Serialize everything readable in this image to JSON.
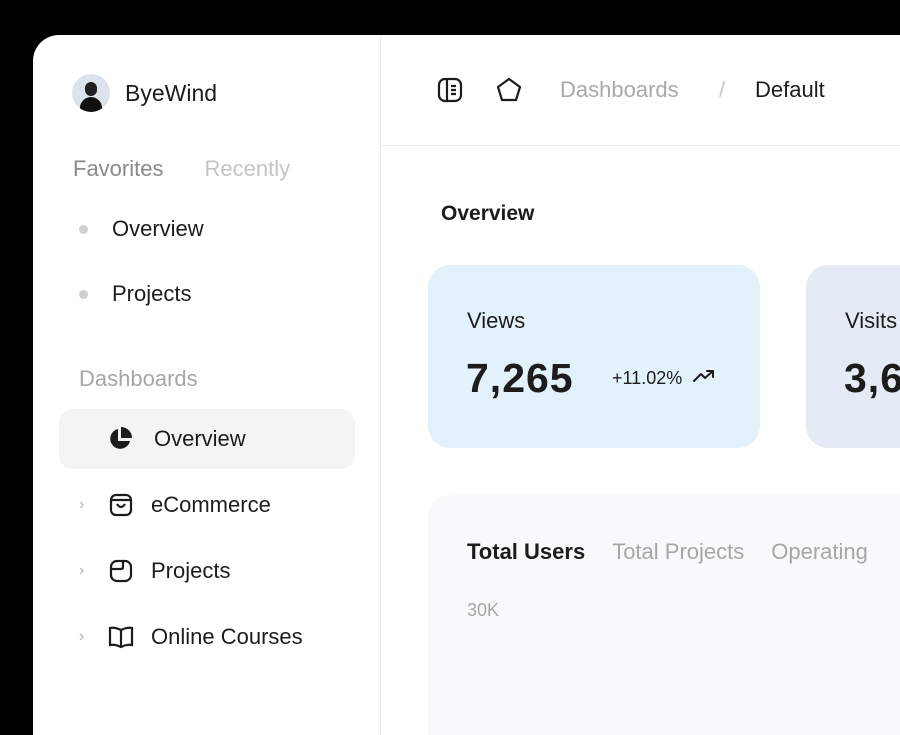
{
  "sidebar": {
    "brand": "ByeWind",
    "tabs": [
      "Favorites",
      "Recently"
    ],
    "favorites": [
      "Overview",
      "Projects"
    ],
    "section": "Dashboards",
    "active_item": "Overview",
    "items": [
      "eCommerce",
      "Projects",
      "Online Courses"
    ]
  },
  "header": {
    "breadcrumb_parent": "Dashboards",
    "breadcrumb_sep": "/",
    "breadcrumb_current": "Default"
  },
  "main": {
    "title": "Overview",
    "cards": [
      {
        "label": "Views",
        "value": "7,265",
        "change": "+11.02%"
      },
      {
        "label": "Visits",
        "value": "3,6"
      }
    ],
    "panel": {
      "tabs": [
        "Total Users",
        "Total Projects",
        "Operating"
      ],
      "y_tick": "30K"
    }
  },
  "colors": {
    "card_views_bg": "#e3f1fb",
    "card_visits_bg": "#e5ebf5",
    "active_nav_bg": "#f4f4f4"
  }
}
